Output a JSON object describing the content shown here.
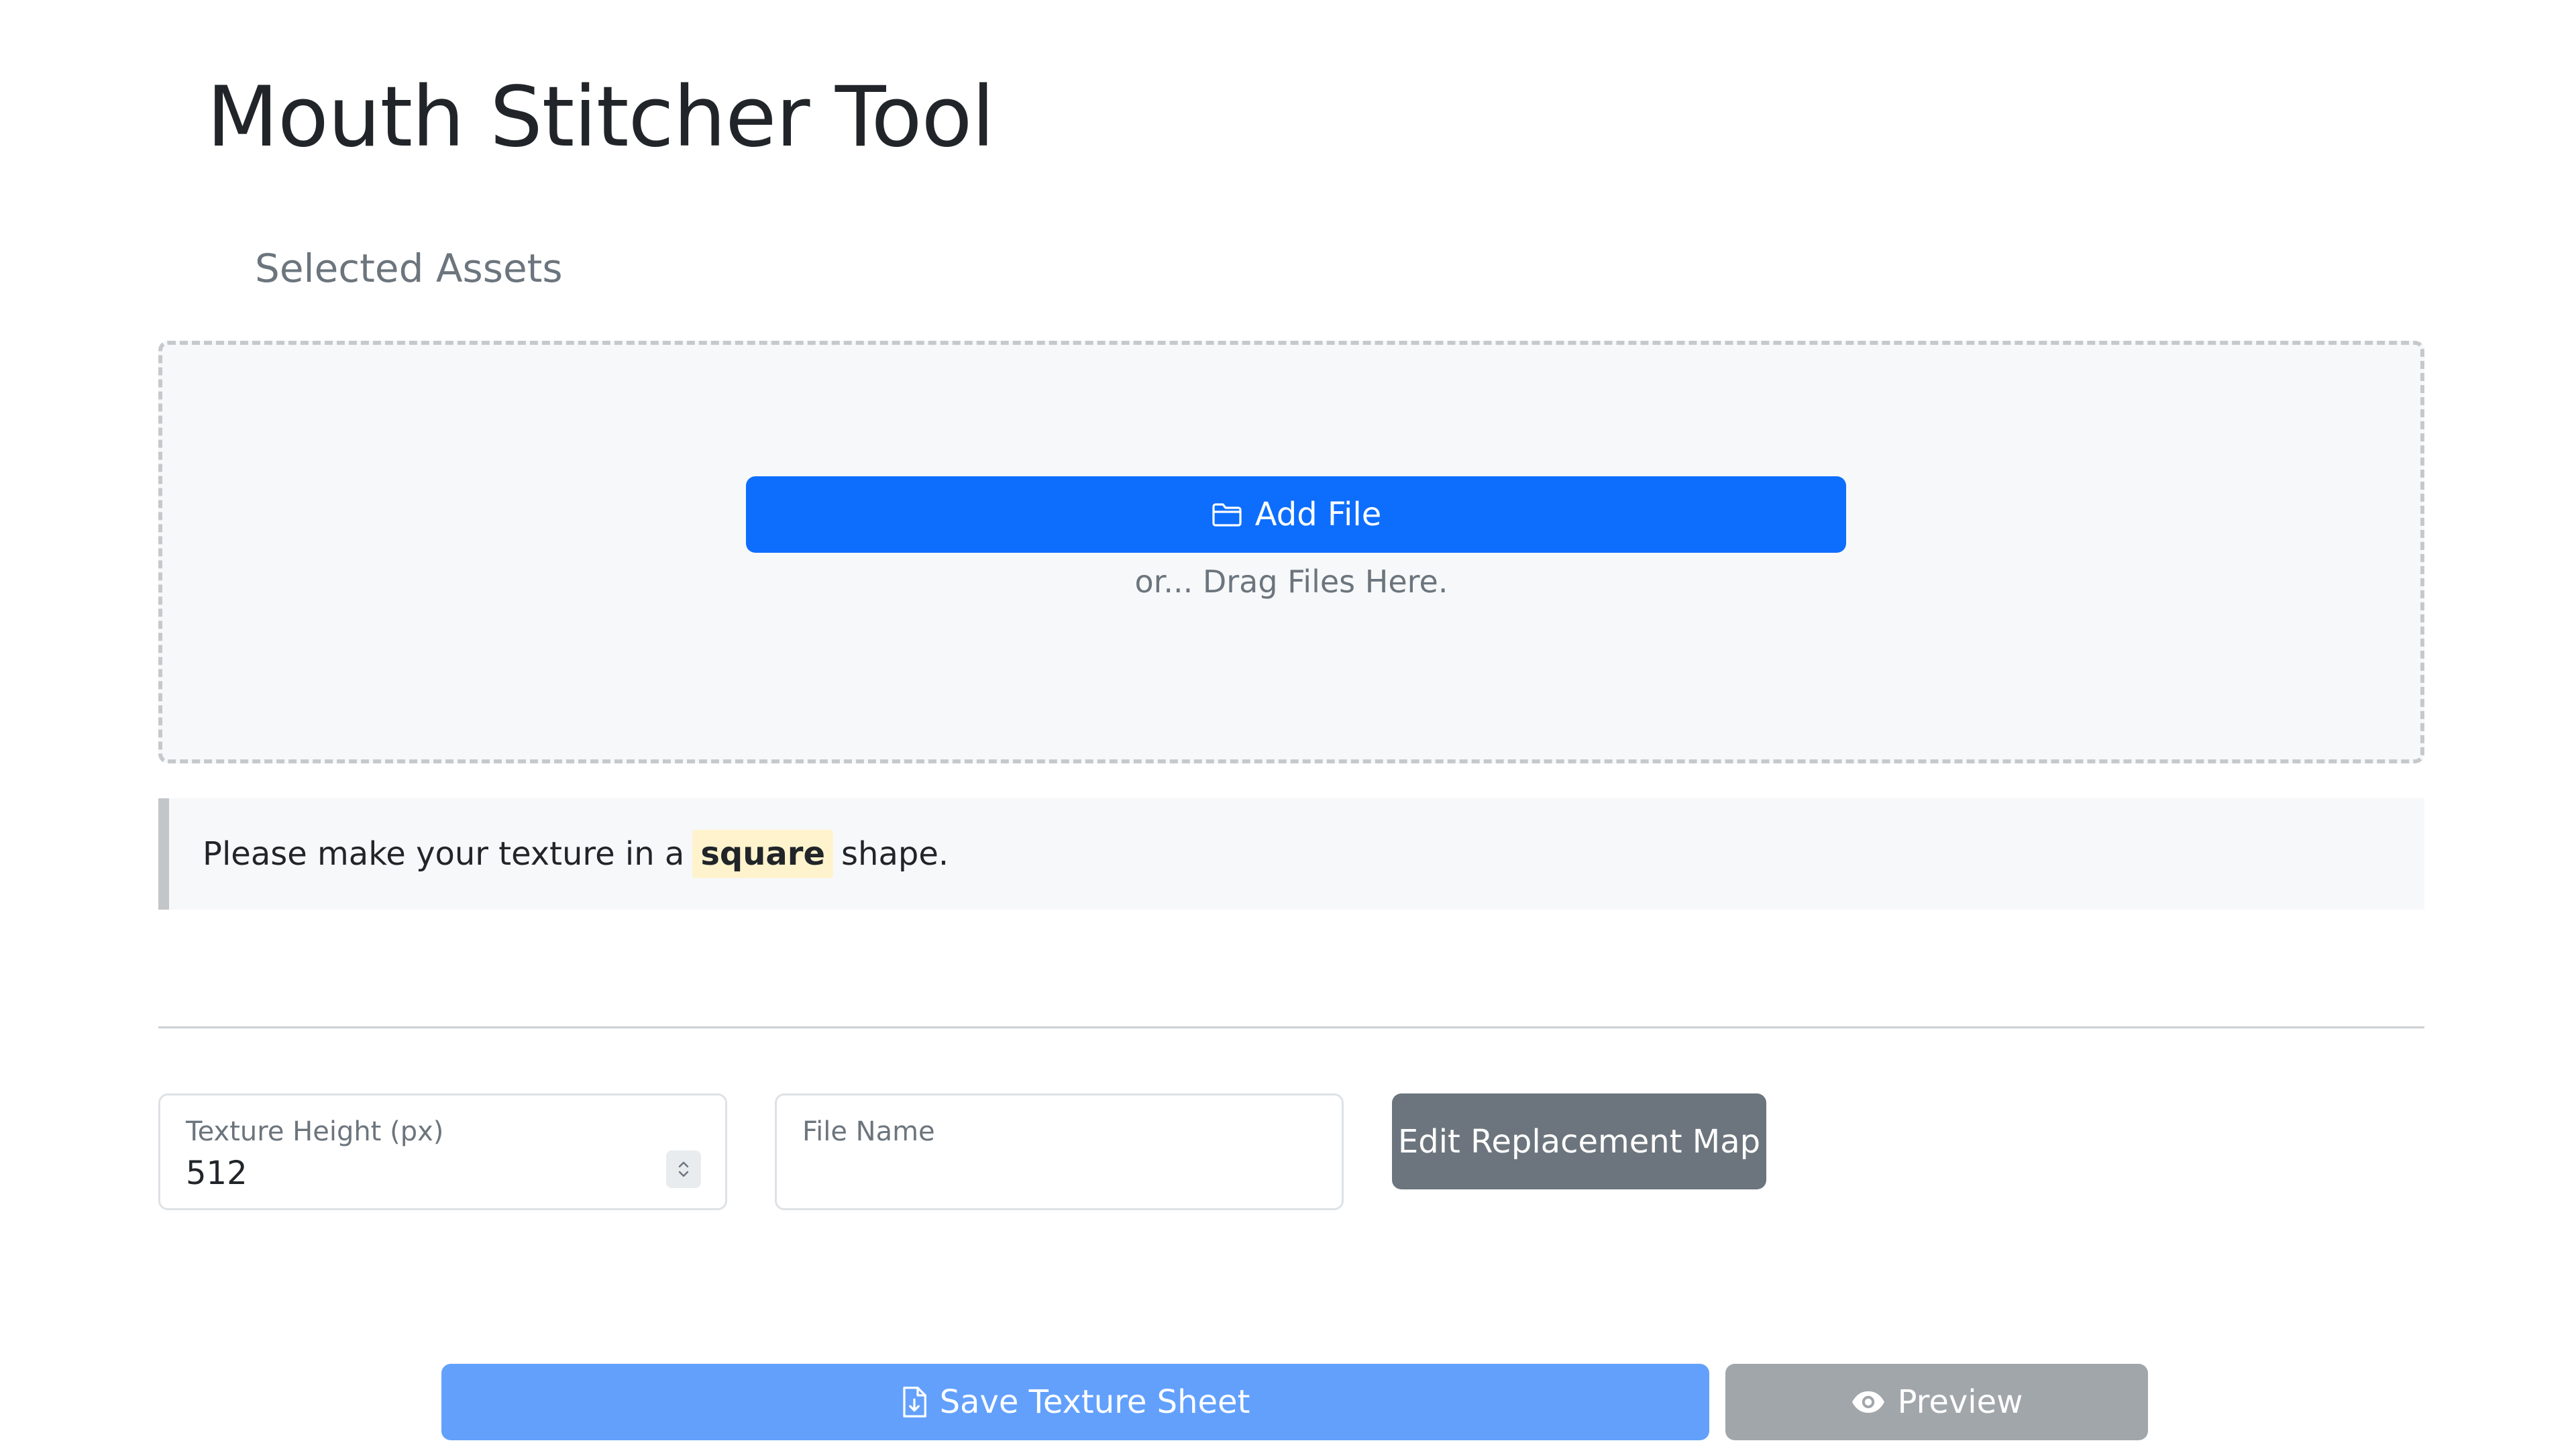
{
  "app": {
    "title": "Mouth Stitcher Tool"
  },
  "assets": {
    "heading": "Selected Assets",
    "add_file_label": "Add File",
    "add_file_icon": "folder-icon",
    "drag_hint": "or... Drag Files Here."
  },
  "notice": {
    "text_before": "Please make your texture in a",
    "highlight": "square",
    "text_after": "shape."
  },
  "settings": {
    "texture_height": {
      "label": "Texture Height (px)",
      "value": "512"
    },
    "file_name": {
      "label": "File Name",
      "value": ""
    },
    "edit_map_label": "Edit Replacement Map"
  },
  "actions": {
    "save_label": "Save Texture Sheet",
    "save_icon": "file-download-icon",
    "preview_label": "Preview",
    "preview_icon": "eye-icon"
  },
  "colors": {
    "primary": "#0d6efd",
    "primary_disabled": "#62a0fc",
    "secondary": "#6c757d",
    "secondary_disabled": "#a1a6ab",
    "highlight_bg": "#fff3cd"
  }
}
